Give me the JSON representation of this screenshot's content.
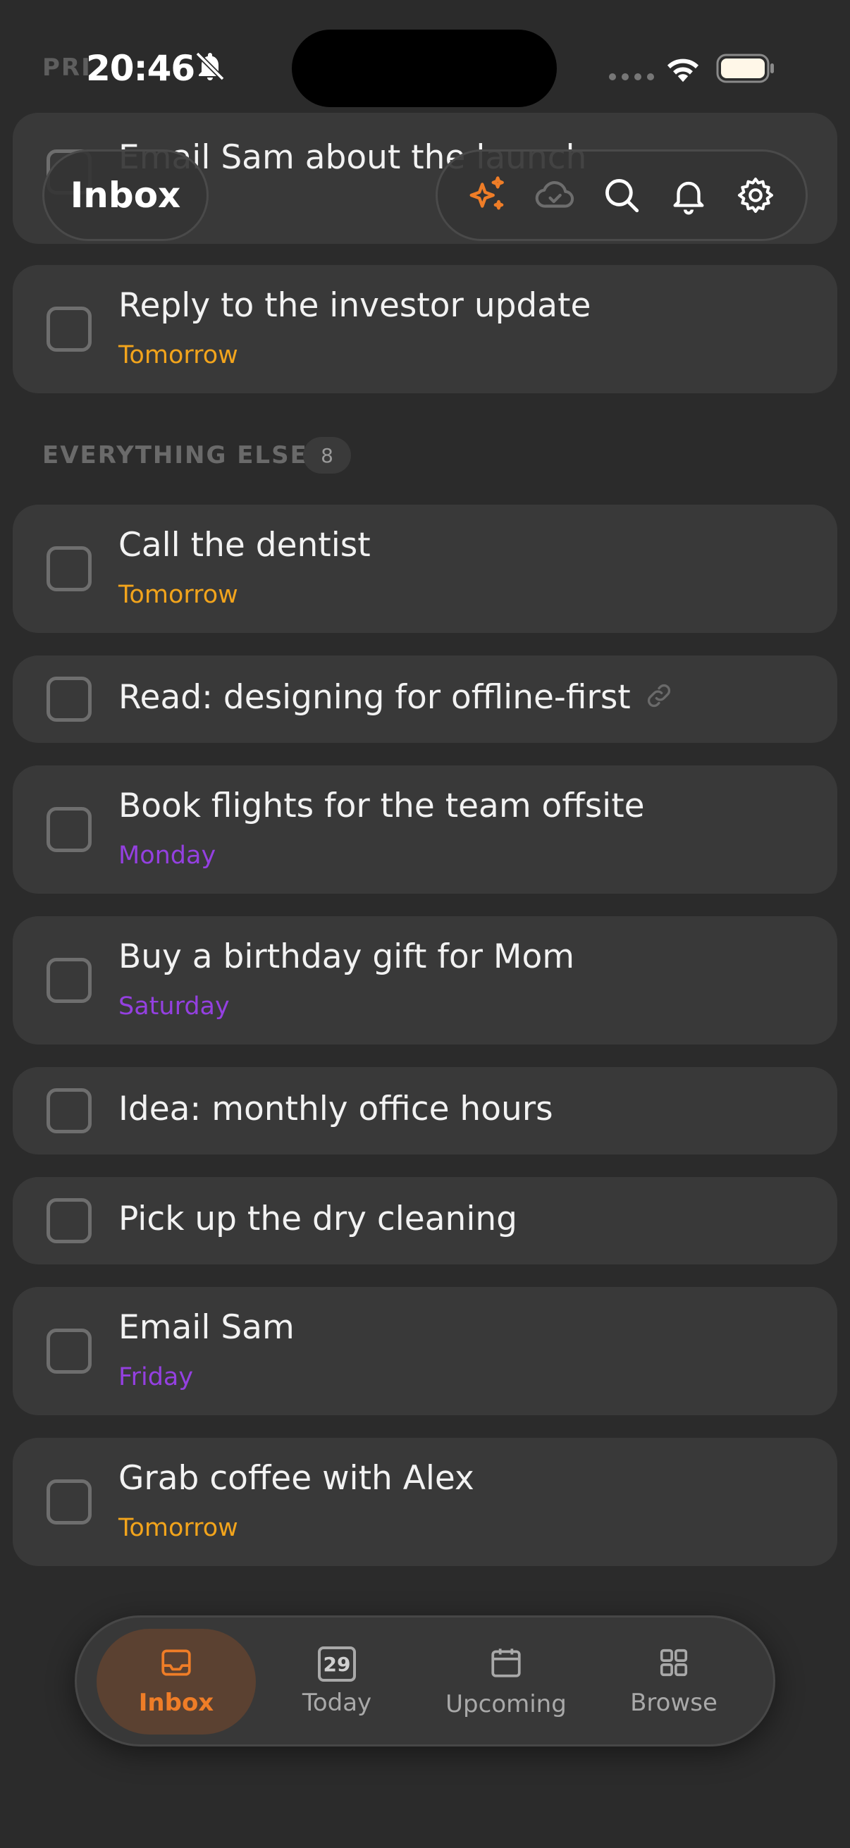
{
  "status_bar": {
    "time": "20:46"
  },
  "header": {
    "title": "Inbox",
    "actions": [
      "ai-sparkle",
      "sync",
      "search",
      "notifications",
      "settings"
    ]
  },
  "sections": {
    "priority_partial": "PRI",
    "everything_else": {
      "label": "EVERYTHING ELSE",
      "count": "8"
    }
  },
  "tasks": [
    {
      "title": "Email Sam about the launch",
      "date": ""
    },
    {
      "title": "Reply to the investor update",
      "date": "Tomorrow"
    },
    {
      "title": "Call the dentist",
      "date": "Tomorrow"
    },
    {
      "title": "Read: designing for offline-first",
      "date": ""
    },
    {
      "title": "Book flights for the team offsite",
      "date": "Monday"
    },
    {
      "title": "Buy a birthday gift for Mom",
      "date": "Saturday"
    },
    {
      "title": "Idea: monthly office hours",
      "date": ""
    },
    {
      "title": "Pick up the dry cleaning",
      "date": ""
    },
    {
      "title": "Email Sam",
      "date": "Friday"
    },
    {
      "title": "Grab coffee with Alex",
      "date": "Tomorrow"
    }
  ],
  "tabbar": {
    "tabs": [
      {
        "label": "Inbox",
        "icon": "inbox-icon",
        "active": true
      },
      {
        "label": "Today",
        "icon": "calendar-day-icon",
        "day": "29"
      },
      {
        "label": "Upcoming",
        "icon": "calendar-icon"
      },
      {
        "label": "Browse",
        "icon": "grid-icon"
      }
    ]
  },
  "colors": {
    "accent": "#ef7d27",
    "date_soon": "#f2a41c",
    "date_week": "#9440e0",
    "background": "#2b2b2b",
    "card": "#393939"
  }
}
